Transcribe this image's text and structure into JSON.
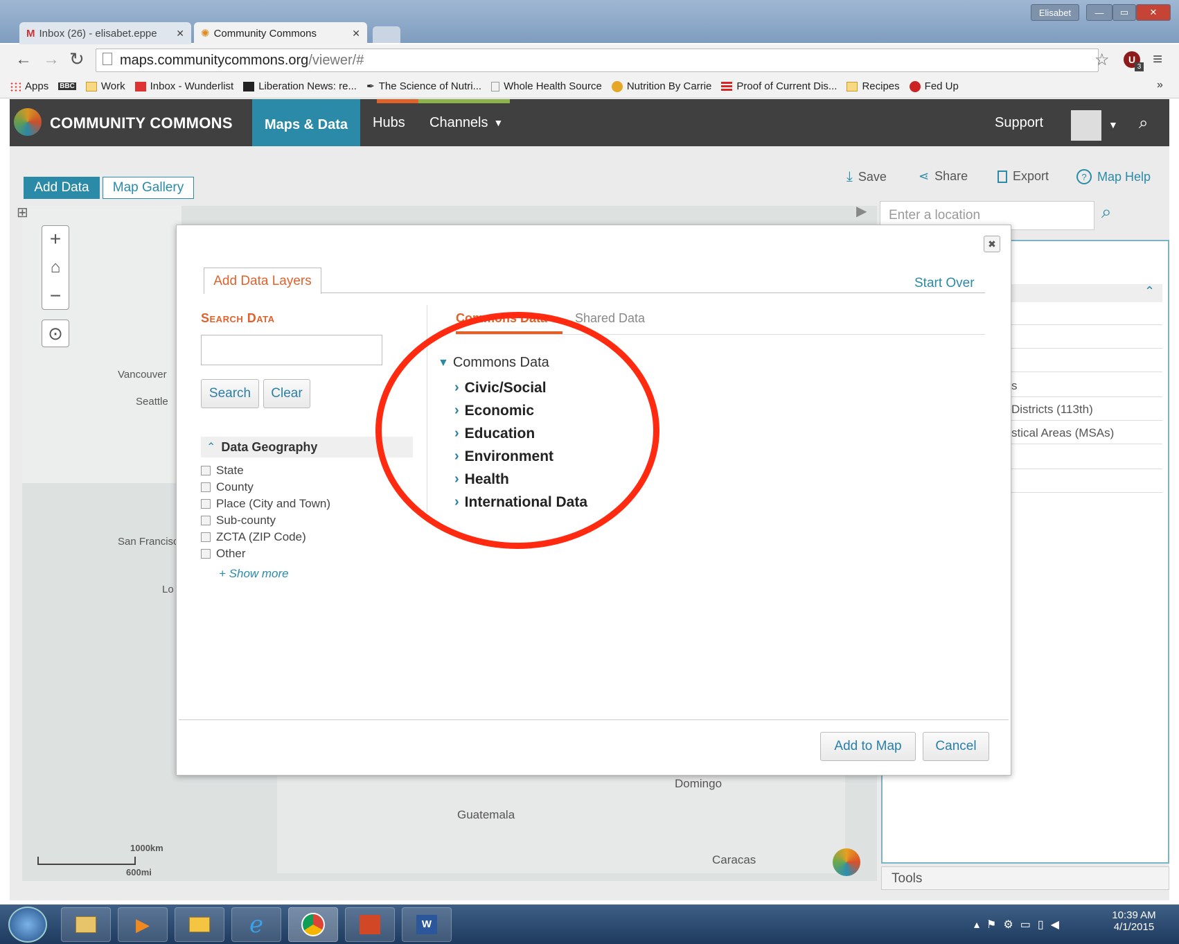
{
  "browser": {
    "tabs": [
      {
        "label": "Inbox (26) - elisabet.eppe"
      },
      {
        "label": "Community Commons"
      }
    ],
    "window_user": "Elisabet",
    "url_host": "maps.communitycommons.org",
    "url_path": "/viewer/#",
    "ext_badge": "3",
    "bookmarks": [
      "Apps",
      "Work",
      "Inbox - Wunderlist",
      "Liberation News: re...",
      "The Science of Nutri...",
      "Whole Health Source",
      "Nutrition By Carrie",
      "Proof of Current Dis...",
      "Recipes",
      "Fed Up"
    ],
    "bookmarks_more": "»"
  },
  "site": {
    "brand": "COMMUNITY COMMONS",
    "nav": [
      "Maps & Data",
      "Hubs",
      "Channels"
    ],
    "support": "Support"
  },
  "viewer": {
    "tabs": [
      "Add Data",
      "Map Gallery"
    ],
    "actions": [
      "Save",
      "Share",
      "Export",
      "Map Help"
    ],
    "location_placeholder": "Enter a location",
    "map_labels": [
      "Vancouver",
      "Seattle",
      "San Francisc",
      "Lo",
      "Domingo",
      "Guatemala",
      "Caracas"
    ],
    "scale": [
      "1000km",
      "600mi"
    ],
    "right_panel_partial": [
      "s",
      "Districts (113th)",
      "stical Areas (MSAs)"
    ],
    "tools": "Tools"
  },
  "modal": {
    "tab": "Add Data Layers",
    "start_over": "Start Over",
    "search_title": "Search Data",
    "search_button": "Search",
    "clear_button": "Clear",
    "geo_title": "Data Geography",
    "geo_options": [
      "State",
      "County",
      "Place (City and Town)",
      "Sub-county",
      "ZCTA (ZIP Code)",
      "Other"
    ],
    "show_more": "+ Show more",
    "data_tabs": [
      "Commons Data",
      "Shared Data"
    ],
    "tree_root": "Commons Data",
    "tree_items": [
      "Civic/Social",
      "Economic",
      "Education",
      "Environment",
      "Health",
      "International Data"
    ],
    "add_button": "Add to Map",
    "cancel_button": "Cancel",
    "close": "✖"
  },
  "taskbar": {
    "time": "10:39 AM",
    "date": "4/1/2015"
  },
  "colors": {
    "accent": "#2a7fa6",
    "orange": "#e0612a",
    "annotation": "#ff2a10"
  }
}
